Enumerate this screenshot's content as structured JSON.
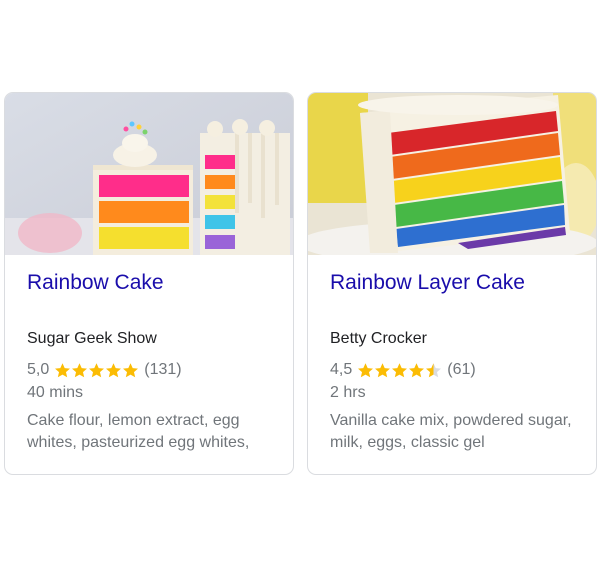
{
  "cards": [
    {
      "title": "Rainbow Cake",
      "source": "Sugar Geek Show",
      "rating": "5,0",
      "stars": 5,
      "review_count": "(131)",
      "time": "40 mins",
      "ingredients": "Cake flour, lemon extract, egg whites, pasteurized egg whites,"
    },
    {
      "title": "Rainbow Layer Cake",
      "source": "Betty Crocker",
      "rating": "4,5",
      "stars": 4.5,
      "review_count": "(61)",
      "time": "2 hrs",
      "ingredients": "Vanilla cake mix, powdered sugar, milk, eggs, classic gel"
    }
  ],
  "colors": {
    "star": "#fbbc04",
    "star_empty": "#dadce0",
    "link": "#1a0dab",
    "muted": "#70757a"
  }
}
